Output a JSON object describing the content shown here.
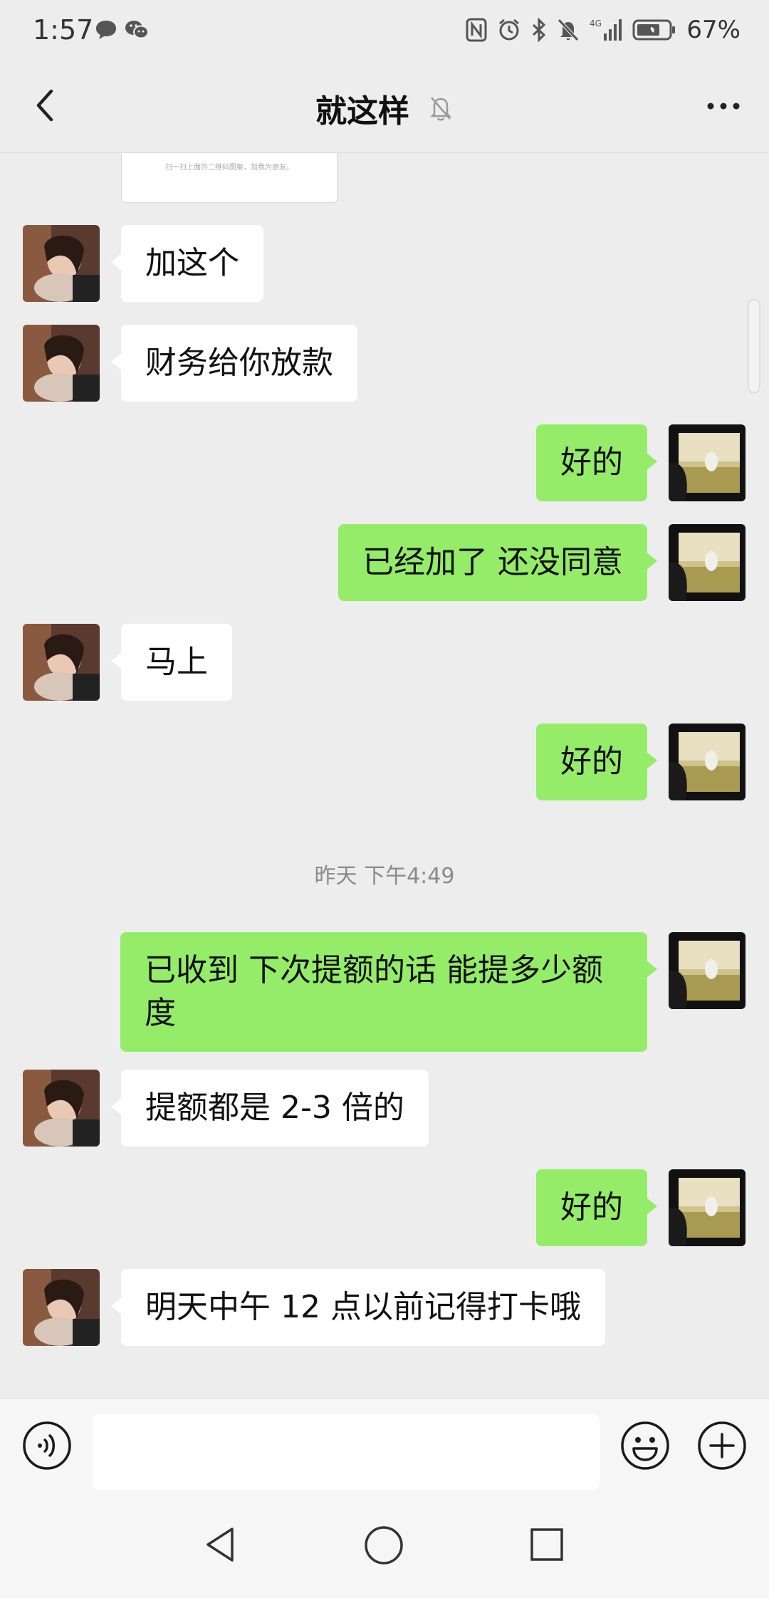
{
  "status_bar": {
    "time": "1:57",
    "battery_percent": "67%",
    "left_icons": [
      "message-bubble-icon",
      "wechat-icon"
    ],
    "right_icons": [
      "nfc-icon",
      "alarm-icon",
      "bluetooth-icon",
      "mute-bell-icon",
      "signal-4g-icon",
      "battery-icon"
    ]
  },
  "header": {
    "title": "就这样",
    "muted": true
  },
  "chat": {
    "card_stub_text": "扫一扫上面的二维码图案，加我为朋友。",
    "messages": [
      {
        "side": "left",
        "text": "加这个"
      },
      {
        "side": "left",
        "text": "财务给你放款"
      },
      {
        "side": "right",
        "text": "好的"
      },
      {
        "side": "right",
        "text": "已经加了 还没同意"
      },
      {
        "side": "left",
        "text": "马上"
      },
      {
        "side": "right",
        "text": "好的"
      },
      {
        "side": "right",
        "text": "已收到 下次提额的话 能提多少额度"
      },
      {
        "side": "left",
        "text": "提额都是 2-3 倍的"
      },
      {
        "side": "right",
        "text": "好的"
      },
      {
        "side": "left",
        "text": "明天中午 12 点以前记得打卡哦"
      }
    ],
    "timestamp": "昨天 下午4:49"
  },
  "input_bar": {
    "value": "",
    "placeholder": ""
  },
  "colors": {
    "background": "#ededed",
    "my_bubble": "#95ec69",
    "their_bubble": "#ffffff"
  }
}
